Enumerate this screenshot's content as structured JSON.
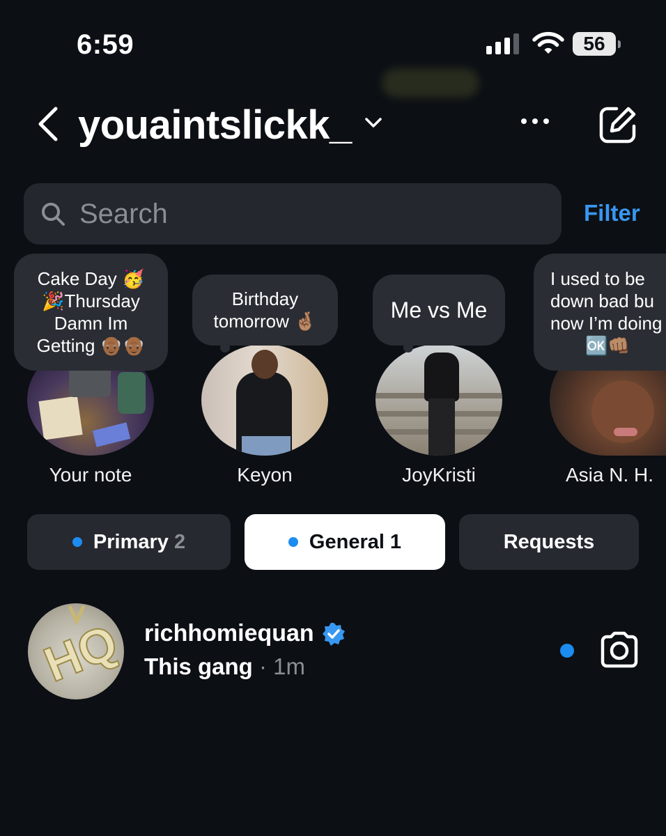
{
  "status_bar": {
    "time": "6:59",
    "battery": "56"
  },
  "header": {
    "username": "youaintslickk_",
    "icons": [
      "chevron-left-icon",
      "chevron-down-icon",
      "more-icon",
      "compose-icon"
    ]
  },
  "search": {
    "placeholder": "Search",
    "filter_label": "Filter"
  },
  "notes": [
    {
      "name": "Your note",
      "text_lines": [
        "Cake Day 🥳",
        "🎉Thursday",
        "Damn Im",
        "Getting 👴🏾👴🏾"
      ]
    },
    {
      "name": "Keyon",
      "text_lines": [
        "Birthday",
        "tomorrow 🤞🏽"
      ]
    },
    {
      "name": "JoyKristi",
      "text_lines": [
        "Me vs Me"
      ]
    },
    {
      "name": "Asia N. H.",
      "text_lines": [
        "I used to be",
        "down bad bu",
        "now I’m doing",
        "🆗👊🏽"
      ]
    }
  ],
  "tabs": [
    {
      "label": "Primary",
      "count": "2",
      "has_dot": true,
      "active": false
    },
    {
      "label": "General",
      "count": "1",
      "has_dot": true,
      "active": true
    },
    {
      "label": "Requests",
      "count": "",
      "has_dot": false,
      "active": false
    }
  ],
  "threads": [
    {
      "name": "richhomiequan",
      "verified": true,
      "preview": "This gang",
      "time": "· 1m",
      "unread": true
    }
  ],
  "colors": {
    "background": "#0c0f14",
    "accent": "#3897f0",
    "unread": "#1d8cf0",
    "surface": "#24272d"
  }
}
